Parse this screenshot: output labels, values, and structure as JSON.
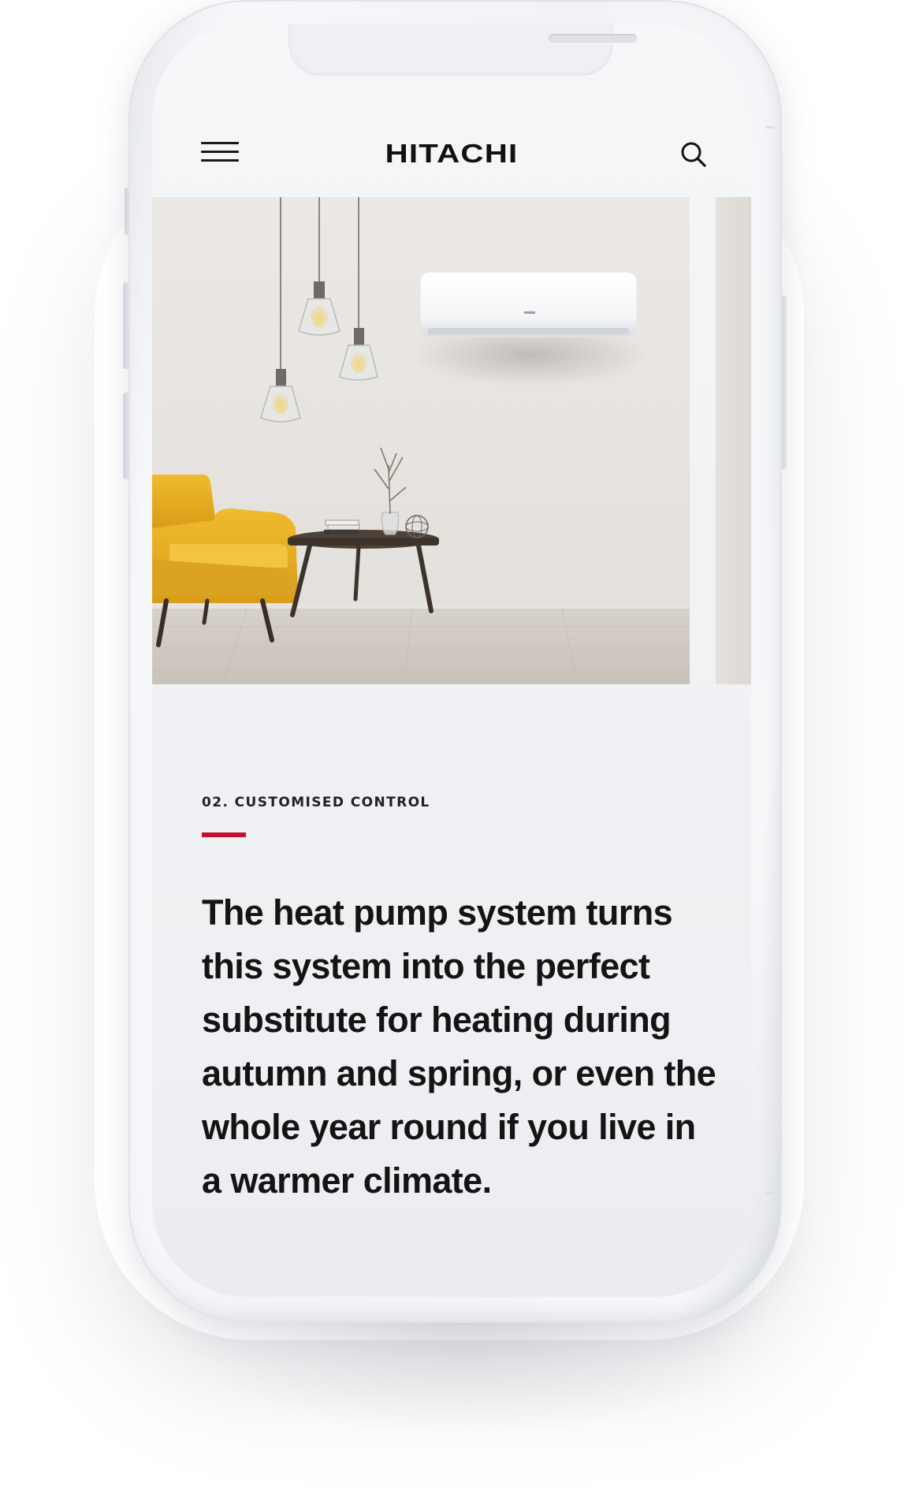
{
  "header": {
    "brand": "HITACHI",
    "menu_icon": "hamburger-menu-icon",
    "search_icon": "search-icon"
  },
  "carousel": {
    "current_slide": {
      "image": "living-room-with-air-conditioner",
      "objects": [
        "pendant-lamps",
        "wall-air-conditioner",
        "yellow-armchair",
        "round-coffee-table",
        "vase-with-branches",
        "books",
        "decorative-sphere"
      ]
    },
    "has_next_slide": true
  },
  "content": {
    "eyebrow": "02. CUSTOMISED CONTROL",
    "body": "The heat pump system turns this system into the perfect substitute for heating during autumn and spring, or even the whole year round if you live in a warmer climate."
  },
  "colors": {
    "accent": "#c4102e",
    "text": "#141414",
    "screen_bg": "#f1f2f4"
  }
}
